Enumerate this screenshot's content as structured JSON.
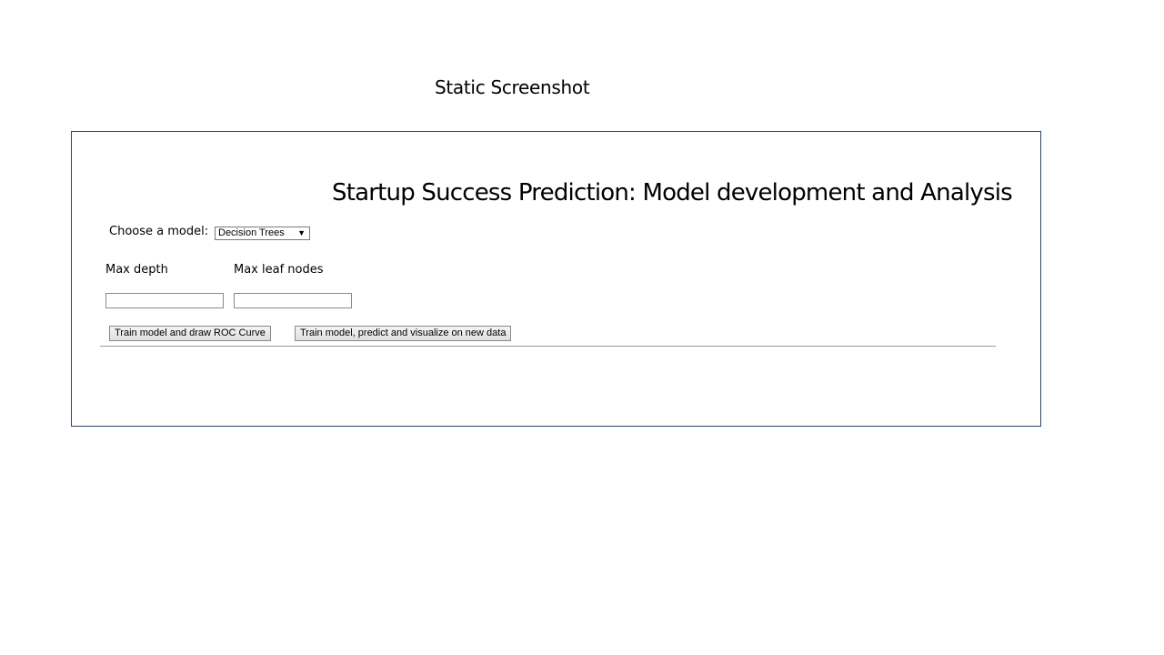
{
  "caption": "Static Screenshot",
  "app": {
    "title": "Startup Success Prediction: Model development and Analysis",
    "model_label": "Choose a model:",
    "model_selected": "Decision Trees",
    "fields": [
      {
        "label": "Max depth",
        "value": ""
      },
      {
        "label": "Max leaf nodes",
        "value": ""
      }
    ],
    "buttons": {
      "train_roc": "Train model and draw ROC Curve",
      "train_predict": "Train model, predict and visualize on new data"
    }
  },
  "icons": {
    "select_arrow": "caret-down-icon"
  },
  "colors": {
    "frame_border": "#2f4466"
  }
}
